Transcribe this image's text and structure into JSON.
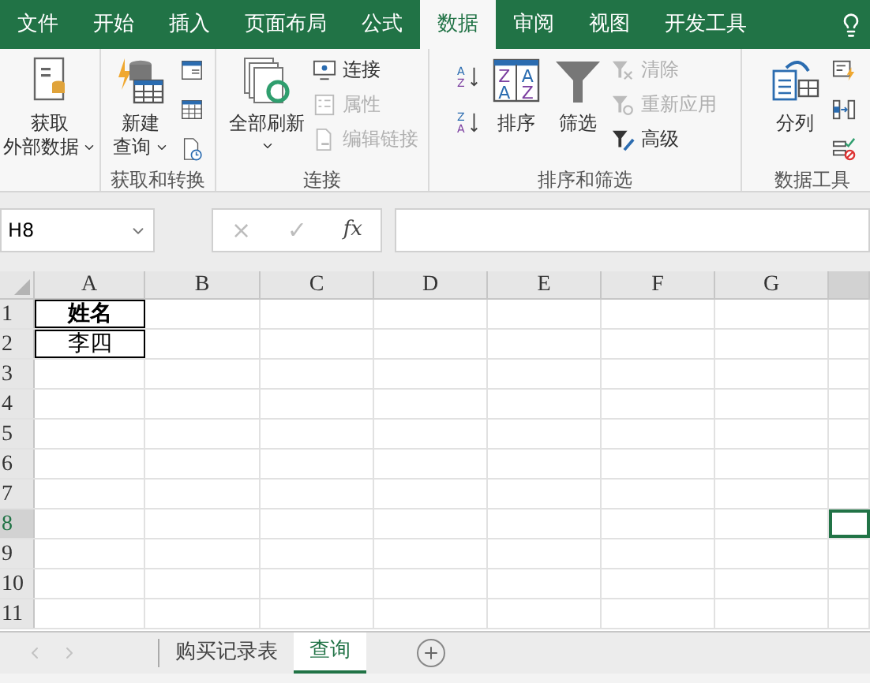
{
  "tabs": [
    {
      "label": "文件",
      "selected": false
    },
    {
      "label": "开始",
      "selected": false
    },
    {
      "label": "插入",
      "selected": false
    },
    {
      "label": "页面布局",
      "selected": false
    },
    {
      "label": "公式",
      "selected": false
    },
    {
      "label": "数据",
      "selected": true
    },
    {
      "label": "审阅",
      "selected": false
    },
    {
      "label": "视图",
      "selected": false
    },
    {
      "label": "开发工具",
      "selected": false
    }
  ],
  "ribbon_groups": [
    {
      "items": [
        {
          "kind": "large",
          "lines": [
            "获取",
            "外部数据"
          ],
          "dropdown": true
        }
      ]
    },
    {
      "label": "获取和转换",
      "items": [
        {
          "kind": "large",
          "lines": [
            "新建",
            "查询"
          ],
          "dropdown": true
        },
        {
          "kind": "iconstack"
        }
      ]
    },
    {
      "label": "连接",
      "items": [
        {
          "kind": "large",
          "lines": [
            "全部刷新"
          ],
          "dropdown": true
        },
        {
          "kind": "small",
          "entries": [
            {
              "label": "连接",
              "disabled": false
            },
            {
              "label": "属性",
              "disabled": true
            },
            {
              "label": "编辑链接",
              "disabled": true
            }
          ]
        }
      ]
    },
    {
      "label": "排序和筛选",
      "items": [
        {
          "kind": "sortstack",
          "buttons": [
            {
              "letters": [
                "A",
                "Z"
              ]
            },
            {
              "letters": [
                "Z",
                "A"
              ]
            }
          ]
        },
        {
          "kind": "large",
          "lines": [
            "排序"
          ],
          "dropdown": false,
          "letters": [
            "Z",
            "A",
            "A",
            "Z"
          ]
        },
        {
          "kind": "large",
          "lines": [
            "筛选"
          ],
          "dropdown": false
        },
        {
          "kind": "small",
          "entries": [
            {
              "label": "清除",
              "disabled": true
            },
            {
              "label": "重新应用",
              "disabled": true
            },
            {
              "label": "高级",
              "disabled": false
            }
          ]
        }
      ]
    },
    {
      "label": "数据工具",
      "items": [
        {
          "kind": "large",
          "lines": [
            "分列"
          ],
          "dropdown": false
        },
        {
          "kind": "iconstack"
        }
      ]
    }
  ],
  "name_box": "H8",
  "formula_buttons": [
    {
      "label": "×",
      "disabled": true
    },
    {
      "label": "✓",
      "disabled": true
    },
    {
      "label": "fx",
      "disabled": false
    }
  ],
  "columns": [
    {
      "label": "A",
      "selected": false
    },
    {
      "label": "B",
      "selected": false
    },
    {
      "label": "C",
      "selected": false
    },
    {
      "label": "D",
      "selected": false
    },
    {
      "label": "E",
      "selected": false
    },
    {
      "label": "F",
      "selected": false
    },
    {
      "label": "G",
      "selected": false
    },
    {
      "selected": true
    }
  ],
  "rows": [
    {
      "label": "1",
      "selected": false,
      "cells": [
        {
          "text": "姓名",
          "bold": true
        }
      ]
    },
    {
      "label": "2",
      "selected": false,
      "cells": [
        {
          "text": "李四",
          "bold": false
        }
      ]
    },
    {
      "label": "3",
      "selected": false,
      "cells": []
    },
    {
      "label": "4",
      "selected": false,
      "cells": []
    },
    {
      "label": "5",
      "selected": false,
      "cells": []
    },
    {
      "label": "6",
      "selected": false,
      "cells": []
    },
    {
      "label": "7",
      "selected": false,
      "cells": []
    },
    {
      "label": "8",
      "selected": true,
      "cells": []
    },
    {
      "label": "9",
      "selected": false,
      "cells": []
    },
    {
      "label": "10",
      "selected": false,
      "cells": []
    },
    {
      "label": "11",
      "selected": false,
      "cells": []
    }
  ],
  "sheet_tabs": [
    {
      "label": "购买记录表",
      "selected": false
    },
    {
      "label": "查询",
      "selected": true
    }
  ]
}
